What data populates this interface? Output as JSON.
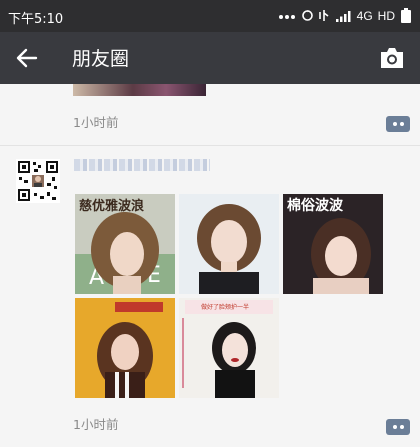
{
  "status_bar": {
    "time": "下午5:10",
    "network": "4G",
    "hd": "HD"
  },
  "navbar": {
    "title": "朋友圈"
  },
  "feed": {
    "previous_post": {
      "timestamp": "1小时前"
    },
    "post": {
      "timestamp": "1小时前",
      "photos": [
        {
          "caption": "慈优雅波浪",
          "bg": "#c9ccc0"
        },
        {
          "caption": "",
          "bg": "#e9eef2"
        },
        {
          "caption": "棉俗波波",
          "bg": "#2b2326"
        },
        {
          "caption": "",
          "bg": "#e7a82b"
        },
        {
          "caption": "做好了脸颊护一半",
          "bg": "#f2f0ec"
        }
      ]
    }
  },
  "colors": {
    "statusbar_bg": "#2e2e30",
    "navbar_bg": "#393a3f",
    "page_bg": "#f5f5f5",
    "comment_button": "#6b7e97",
    "timestamp_text": "#8a8a8a"
  }
}
